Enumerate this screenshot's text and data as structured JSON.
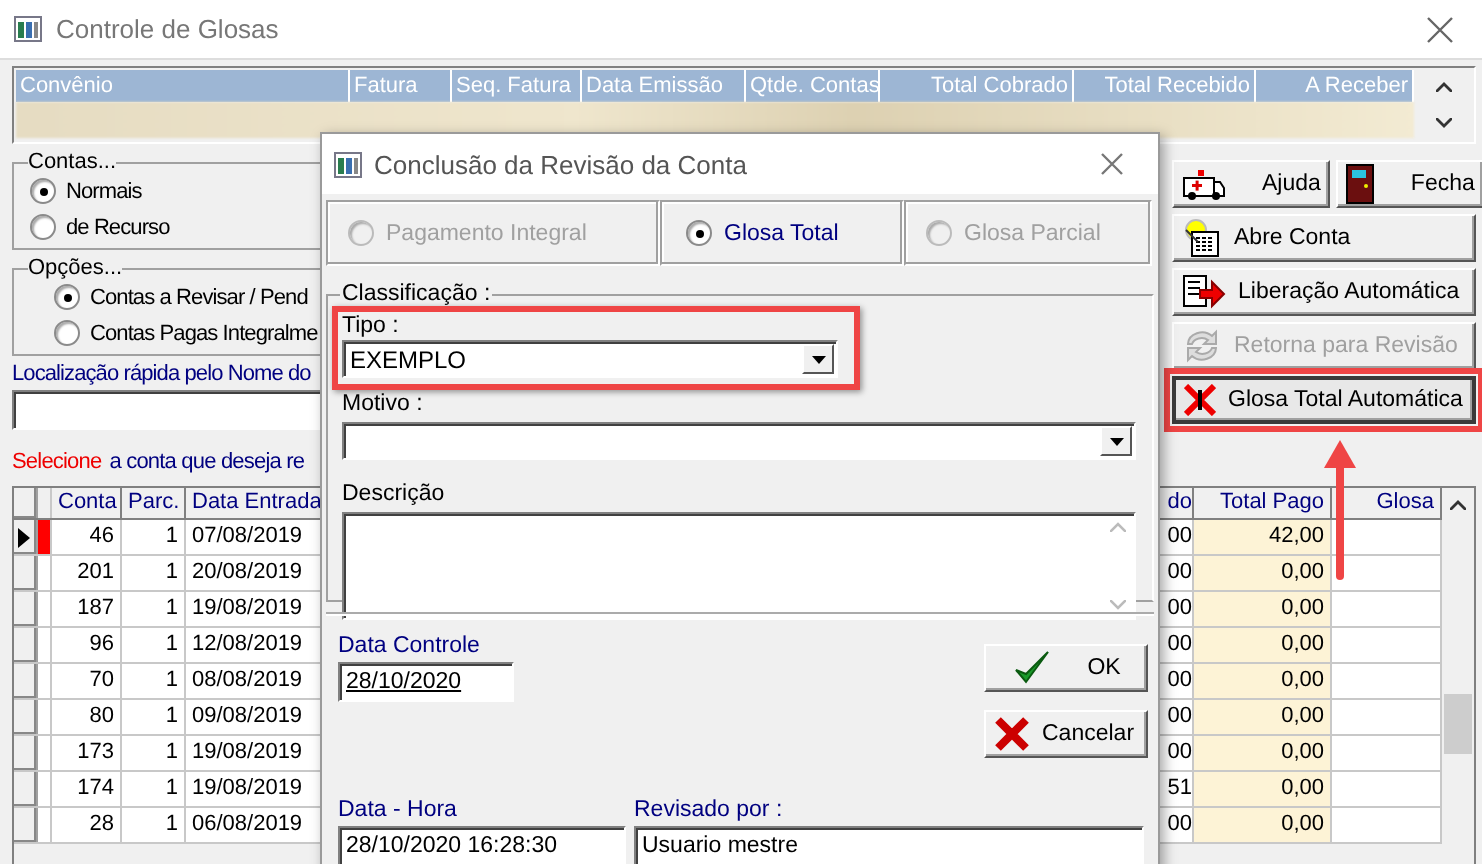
{
  "window": {
    "title": "Controle de Glosas"
  },
  "top_grid": {
    "columns": [
      "Convênio",
      "Fatura",
      "Seq. Fatura",
      "Data Emissão",
      "Qtde. Contas",
      "Total Cobrado",
      "Total Recebido",
      "A Receber"
    ]
  },
  "contas_group": {
    "label": "Contas...",
    "options": [
      {
        "label": "Normais",
        "selected": true
      },
      {
        "label": "de Recurso",
        "selected": false
      }
    ]
  },
  "opcoes_group": {
    "label": "Opções...",
    "options": [
      {
        "label": "Contas a Revisar / Pend",
        "selected": true
      },
      {
        "label": "Contas Pagas Integralme",
        "selected": false
      }
    ]
  },
  "quick_search": {
    "label": "Localização rápida pelo Nome do"
  },
  "hint": {
    "highlight": "Selecione",
    "text": "a conta que deseja re"
  },
  "buttons": [
    {
      "label": "Ajuda",
      "kind": "help",
      "disabled": false,
      "highlighted": false
    },
    {
      "label": "Fecha",
      "kind": "exit",
      "disabled": false,
      "highlighted": false
    },
    {
      "label": "Abre Conta",
      "kind": "open",
      "disabled": false,
      "highlighted": false
    },
    {
      "label": "Liberação Automática",
      "kind": "release",
      "disabled": false,
      "highlighted": false
    },
    {
      "label": "Retorna para Revisão",
      "kind": "return",
      "disabled": true,
      "highlighted": false
    },
    {
      "label": "Glosa Total Automática",
      "kind": "gloss",
      "disabled": false,
      "highlighted": true
    }
  ],
  "accounts_grid": {
    "left_columns": [
      "Conta",
      "Parc.",
      "Data Entrada"
    ],
    "right_columns": [
      "do",
      "Total Pago",
      "Glosa"
    ],
    "rows": [
      {
        "conta": "46",
        "parc": "1",
        "data_entrada": "07/08/2019",
        "column_4": "00",
        "total_pago": "42,00",
        "current": true,
        "flagged": true
      },
      {
        "conta": "201",
        "parc": "1",
        "data_entrada": "20/08/2019",
        "column_4": "00",
        "total_pago": "0,00",
        "current": false,
        "flagged": false
      },
      {
        "conta": "187",
        "parc": "1",
        "data_entrada": "19/08/2019",
        "column_4": "00",
        "total_pago": "0,00",
        "current": false,
        "flagged": false
      },
      {
        "conta": "96",
        "parc": "1",
        "data_entrada": "12/08/2019",
        "column_4": "00",
        "total_pago": "0,00",
        "current": false,
        "flagged": false
      },
      {
        "conta": "70",
        "parc": "1",
        "data_entrada": "08/08/2019",
        "column_4": "00",
        "total_pago": "0,00",
        "current": false,
        "flagged": false
      },
      {
        "conta": "80",
        "parc": "1",
        "data_entrada": "09/08/2019",
        "column_4": "00",
        "total_pago": "0,00",
        "current": false,
        "flagged": false
      },
      {
        "conta": "173",
        "parc": "1",
        "data_entrada": "19/08/2019",
        "column_4": "00",
        "total_pago": "0,00",
        "current": false,
        "flagged": false
      },
      {
        "conta": "174",
        "parc": "1",
        "data_entrada": "19/08/2019",
        "column_4": "51",
        "total_pago": "0,00",
        "current": false,
        "flagged": false
      },
      {
        "conta": "28",
        "parc": "1",
        "data_entrada": "06/08/2019",
        "column_4": "00",
        "total_pago": "0,00",
        "current": false,
        "flagged": false
      }
    ]
  },
  "dialog": {
    "title": "Conclusão da Revisão da Conta",
    "result_options": [
      {
        "label": "Pagamento Integral",
        "selected": false,
        "disabled": true
      },
      {
        "label": "Glosa Total",
        "selected": true,
        "disabled": false
      },
      {
        "label": "Glosa Parcial",
        "selected": false,
        "disabled": true
      }
    ],
    "classification": {
      "label": "Classificação :",
      "tipo": {
        "label": "Tipo :",
        "value": "EXEMPLO",
        "highlighted": true
      },
      "motivo": {
        "label": "Motivo :"
      },
      "descricao": {
        "label": "Descrição"
      }
    },
    "data_controle": {
      "label": "Data Controle",
      "value": "28/10/2020"
    },
    "buttons": [
      {
        "label": "OK",
        "kind": "ok"
      },
      {
        "label": "Cancelar",
        "kind": "cancel"
      }
    ],
    "data_hora": {
      "label": "Data - Hora",
      "value": "28/10/2020 16:28:30"
    },
    "revisado_por": {
      "label": "Revisado por :",
      "value": "Usuario mestre"
    }
  }
}
